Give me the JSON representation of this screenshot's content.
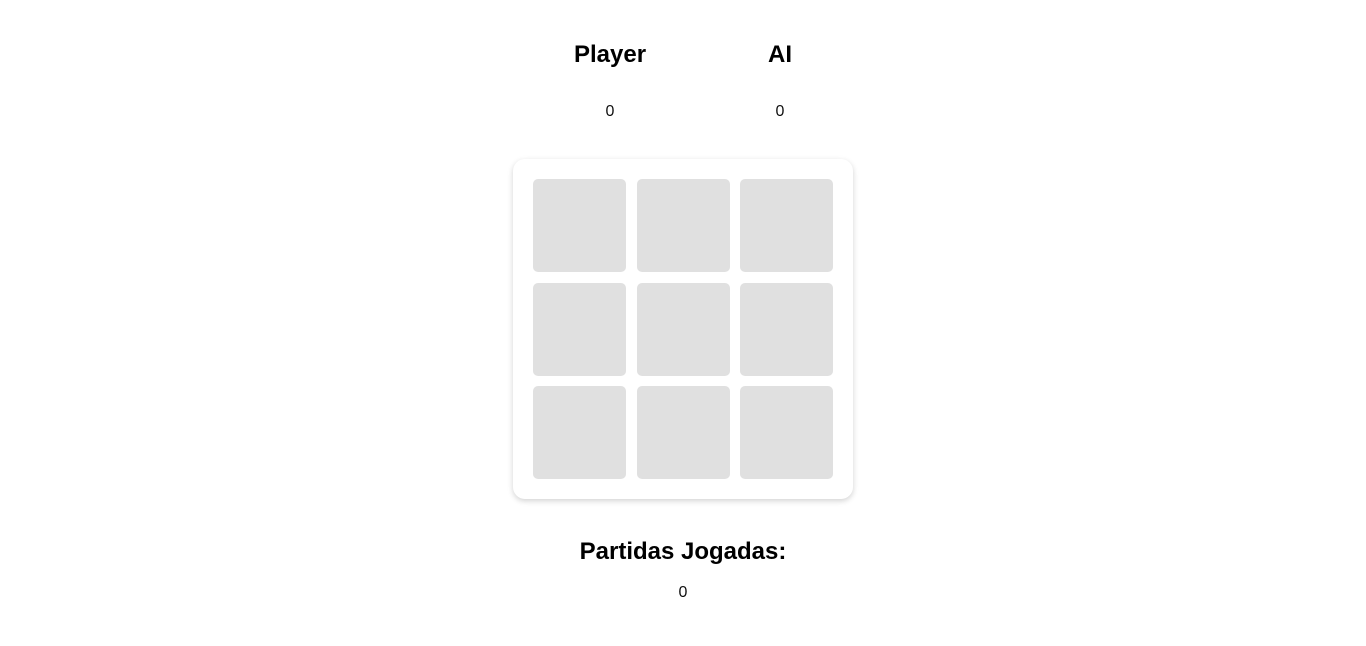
{
  "scoreboard": {
    "player": {
      "label": "Player",
      "score": "0"
    },
    "ai": {
      "label": "AI",
      "score": "0"
    }
  },
  "board": {
    "cells": [
      "",
      "",
      "",
      "",
      "",
      "",
      "",
      "",
      ""
    ],
    "cell_color": "#e0e0e0"
  },
  "games_played": {
    "label": "Partidas Jogadas:",
    "count": "0"
  }
}
